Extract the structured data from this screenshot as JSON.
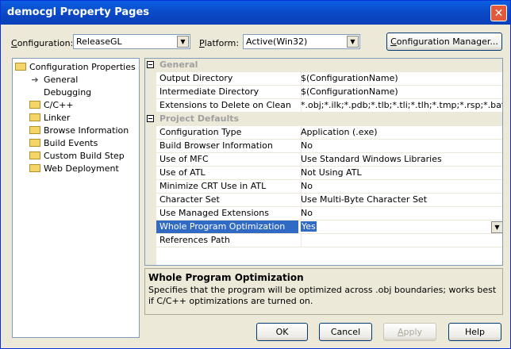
{
  "window": {
    "title": "democgl Property Pages",
    "close": "✕"
  },
  "toolbar": {
    "config_label_u": "C",
    "config_label_rest": "onfiguration:",
    "config_value": "ReleaseGL",
    "platform_label_u": "P",
    "platform_label_rest": "latform:",
    "platform_value": "Active(Win32)",
    "config_manager_u": "C",
    "config_manager_rest": "onfiguration Manager..."
  },
  "tree": {
    "root": "Configuration Properties",
    "items": [
      "General",
      "Debugging",
      "C/C++",
      "Linker",
      "Browse Information",
      "Build Events",
      "Custom Build Step",
      "Web Deployment"
    ]
  },
  "grid": {
    "cat_general": "General",
    "cat_defaults": "Project Defaults",
    "rows": [
      {
        "name": "Output Directory",
        "value": "$(ConfigurationName)"
      },
      {
        "name": "Intermediate Directory",
        "value": "$(ConfigurationName)"
      },
      {
        "name": "Extensions to Delete on Clean",
        "value": "*.obj;*.ilk;*.pdb;*.tlb;*.tli;*.tlh;*.tmp;*.rsp;*.bat;$"
      },
      {
        "name": "Configuration Type",
        "value": "Application (.exe)"
      },
      {
        "name": "Build Browser Information",
        "value": "No"
      },
      {
        "name": "Use of MFC",
        "value": "Use Standard Windows Libraries"
      },
      {
        "name": "Use of ATL",
        "value": "Not Using ATL"
      },
      {
        "name": "Minimize CRT Use in ATL",
        "value": "No"
      },
      {
        "name": "Character Set",
        "value": "Use Multi-Byte Character Set"
      },
      {
        "name": "Use Managed Extensions",
        "value": "No"
      },
      {
        "name": "Whole Program Optimization",
        "value": "Yes"
      },
      {
        "name": "References Path",
        "value": ""
      }
    ]
  },
  "description": {
    "title": "Whole Program Optimization",
    "body": "Specifies that the program will be optimized across .obj boundaries; works best if C/C++ optimizations are turned on."
  },
  "buttons": {
    "ok": "OK",
    "cancel": "Cancel",
    "apply_u": "A",
    "apply_rest": "pply",
    "help": "Help"
  }
}
